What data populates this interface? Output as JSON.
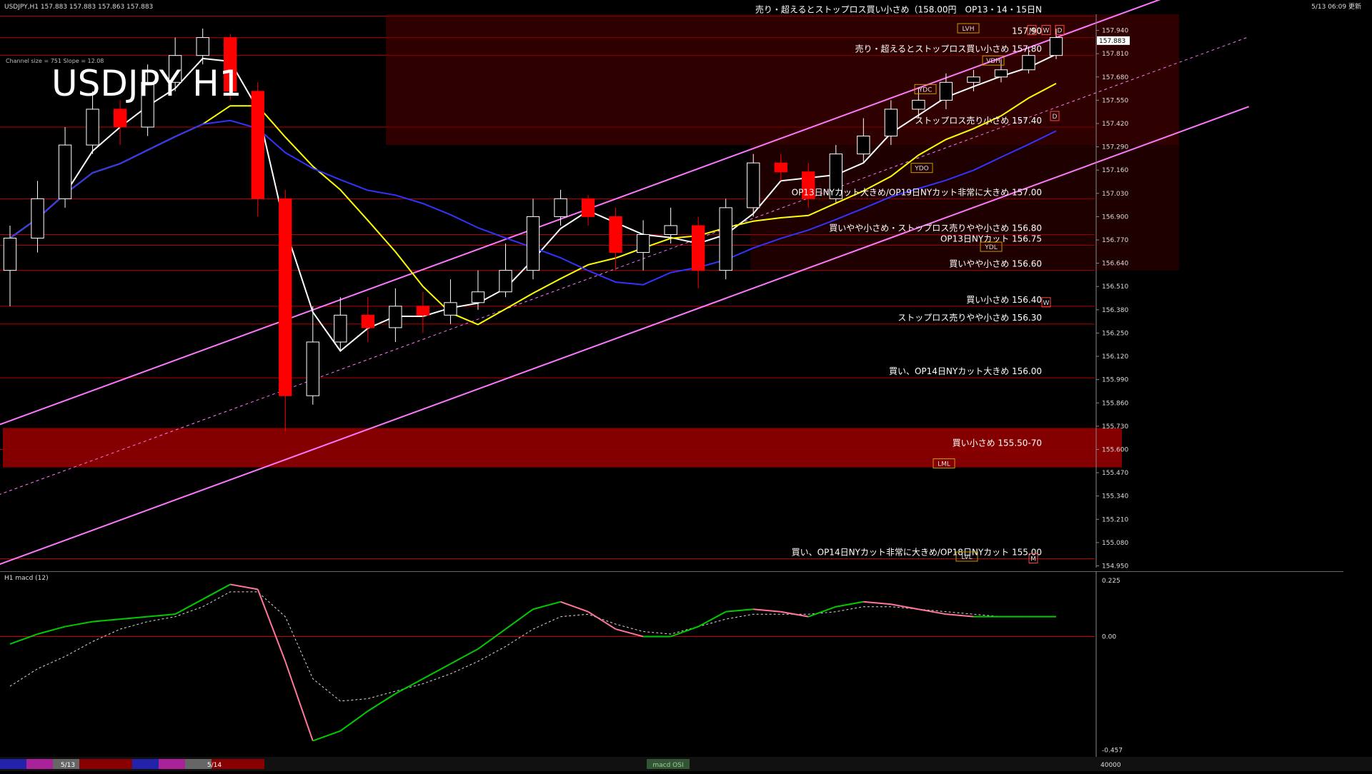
{
  "header": {
    "symbol_line": "USDJPY,H1 157.883 157.883 157.863 157.883",
    "top_right": "5/13 06:09 更新",
    "title": "USDJPY H1",
    "channel_info": "Channel size = 751 Slope = 12.08"
  },
  "colors": {
    "background": "#000000",
    "bull_candle": "#ffffff",
    "bear_candle": "#ff0000",
    "channel": "#ff77ff",
    "ma_white": "#ffffff",
    "ma_yellow": "#ffff00",
    "ma_blue": "#3333ff",
    "macd_bull": "#00cc00",
    "macd_bear": "#ff7799",
    "support_zone": "#8b0000",
    "level_line": "#cc0000"
  },
  "annotations": [
    {
      "text": "売り・超えるとストップロス買い小さめ（158.00円　OP13・14・15日N",
      "price": 158.02
    },
    {
      "text": "157.90",
      "price": 157.9
    },
    {
      "text": "売り・超えるとストップロス買い小さめ 157.80",
      "price": 157.8
    },
    {
      "text": "ストップロス売り小さめ 157.40",
      "price": 157.4
    },
    {
      "text": "OP13日NYカット大きめ/OP19日NYカット非常に大きめ 157.00",
      "price": 157.0
    },
    {
      "text": "買いやや小さめ・ストップロス売りやや小さめ 156.80",
      "price": 156.8
    },
    {
      "text": "OP13日NYカット 156.75",
      "price": 156.74
    },
    {
      "text": "買いやや小さめ 156.60",
      "price": 156.6
    },
    {
      "text": "買い小さめ 156.40",
      "price": 156.4
    },
    {
      "text": "ストップロス売りやや小さめ 156.30",
      "price": 156.3
    },
    {
      "text": "買い、OP14日NYカット大きめ 156.00",
      "price": 156.0
    },
    {
      "text": "買い小さめ 155.50-70",
      "price": 155.6
    },
    {
      "text": "買い、OP14日NYカット非常に大きめ/OP18日NYカット 155.00",
      "price": 154.99
    }
  ],
  "markers": [
    {
      "label": "LVH",
      "price": 157.95
    },
    {
      "label": "VDH",
      "price": 157.77
    },
    {
      "label": "YDC",
      "price": 157.61
    },
    {
      "label": "YDO",
      "price": 157.17
    },
    {
      "label": "YDL",
      "price": 156.73
    },
    {
      "label": "LML",
      "price": 155.52
    },
    {
      "label": "LVL",
      "price": 155.0
    },
    {
      "label": "M",
      "price": 157.94
    },
    {
      "label": "W",
      "price": 157.94
    },
    {
      "label": "D",
      "price": 157.94
    },
    {
      "label": "D",
      "price": 157.46
    },
    {
      "label": "W",
      "price": 156.42
    },
    {
      "label": "M",
      "price": 154.99
    }
  ],
  "chart_data": [
    {
      "type": "candlestick",
      "title": "USDJPY H1",
      "y_ticks": [
        "157.940",
        "157.810",
        "157.680",
        "157.550",
        "157.420",
        "157.290",
        "157.160",
        "157.030",
        "156.900",
        "156.770",
        "156.640",
        "156.510",
        "156.380",
        "156.250",
        "156.120",
        "155.990",
        "155.860",
        "155.730",
        "155.600",
        "155.470",
        "155.340",
        "155.210",
        "155.080",
        "154.950"
      ],
      "x_ticks": [
        "5/13",
        "5/14"
      ],
      "ylim": [
        154.94,
        158.03
      ],
      "current_price": "157.883",
      "close": [
        156.78,
        157.0,
        157.3,
        157.5,
        157.4,
        157.65,
        157.8,
        157.9,
        157.6,
        157.0,
        155.9,
        156.2,
        156.35,
        156.28,
        156.4,
        156.35,
        156.42,
        156.48,
        156.6,
        156.9,
        157.0,
        156.9,
        156.7,
        156.8,
        156.85,
        156.6,
        156.95,
        157.2,
        157.15,
        157.0,
        157.25,
        157.35,
        157.5,
        157.55,
        157.65,
        157.68,
        157.72,
        157.8,
        157.9
      ],
      "open": [
        156.6,
        156.78,
        157.0,
        157.3,
        157.5,
        157.4,
        157.65,
        157.8,
        157.9,
        157.6,
        157.0,
        155.9,
        156.2,
        156.35,
        156.28,
        156.4,
        156.35,
        156.42,
        156.48,
        156.6,
        156.9,
        157.0,
        156.9,
        156.7,
        156.8,
        156.85,
        156.6,
        156.95,
        157.2,
        157.15,
        157.0,
        157.25,
        157.35,
        157.5,
        157.55,
        157.65,
        157.68,
        157.72,
        157.8
      ],
      "high": [
        156.85,
        157.1,
        157.4,
        157.6,
        157.55,
        157.75,
        157.9,
        157.95,
        157.92,
        157.65,
        157.05,
        156.4,
        156.45,
        156.45,
        156.5,
        156.48,
        156.55,
        156.6,
        156.75,
        157.0,
        157.05,
        157.02,
        156.95,
        156.88,
        156.95,
        156.9,
        157.0,
        157.25,
        157.25,
        157.2,
        157.3,
        157.45,
        157.55,
        157.62,
        157.7,
        157.72,
        157.78,
        157.85,
        157.95
      ],
      "low": [
        156.4,
        156.7,
        156.95,
        157.25,
        157.3,
        157.35,
        157.6,
        157.75,
        157.55,
        156.9,
        155.7,
        155.85,
        156.15,
        156.2,
        156.2,
        156.25,
        156.3,
        156.38,
        156.45,
        156.55,
        156.85,
        156.85,
        156.6,
        156.6,
        156.75,
        156.5,
        156.55,
        156.9,
        157.1,
        156.95,
        156.98,
        157.2,
        157.3,
        157.45,
        157.5,
        157.6,
        157.65,
        157.7,
        157.78
      ],
      "series": [
        {
          "name": "channel_upper",
          "x": [
            0,
            38
          ],
          "values": [
            155.76,
            157.9
          ]
        },
        {
          "name": "channel_lower",
          "x": [
            0,
            38
          ],
          "values": [
            154.98,
            157.3
          ]
        }
      ]
    },
    {
      "type": "line",
      "title": "H1 macd (12)",
      "y_ticks": [
        "0.225",
        "0.00",
        "-0.457"
      ],
      "ylim": [
        -0.47,
        0.24
      ],
      "series": [
        {
          "name": "macd",
          "values": [
            -0.03,
            0.01,
            0.04,
            0.06,
            0.07,
            0.08,
            0.09,
            0.15,
            0.21,
            0.19,
            -0.1,
            -0.42,
            -0.38,
            -0.3,
            -0.23,
            -0.17,
            -0.11,
            -0.05,
            0.03,
            0.11,
            0.14,
            0.1,
            0.03,
            0.0,
            0.0,
            0.04,
            0.1,
            0.11,
            0.1,
            0.08,
            0.12,
            0.14,
            0.13,
            0.11,
            0.09,
            0.08,
            0.08,
            0.08,
            0.08
          ]
        },
        {
          "name": "signal",
          "values": [
            -0.2,
            -0.13,
            -0.08,
            -0.02,
            0.03,
            0.06,
            0.08,
            0.12,
            0.18,
            0.18,
            0.08,
            -0.17,
            -0.26,
            -0.25,
            -0.22,
            -0.19,
            -0.15,
            -0.1,
            -0.04,
            0.03,
            0.08,
            0.09,
            0.05,
            0.02,
            0.01,
            0.04,
            0.07,
            0.09,
            0.09,
            0.09,
            0.1,
            0.12,
            0.12,
            0.11,
            0.1,
            0.09,
            0.08,
            0.08,
            0.08
          ]
        }
      ]
    }
  ],
  "legend_bar": {
    "left_date": "5/13",
    "right_date": "5/14",
    "macd_label": "macd OSI",
    "right_value": "40000"
  }
}
